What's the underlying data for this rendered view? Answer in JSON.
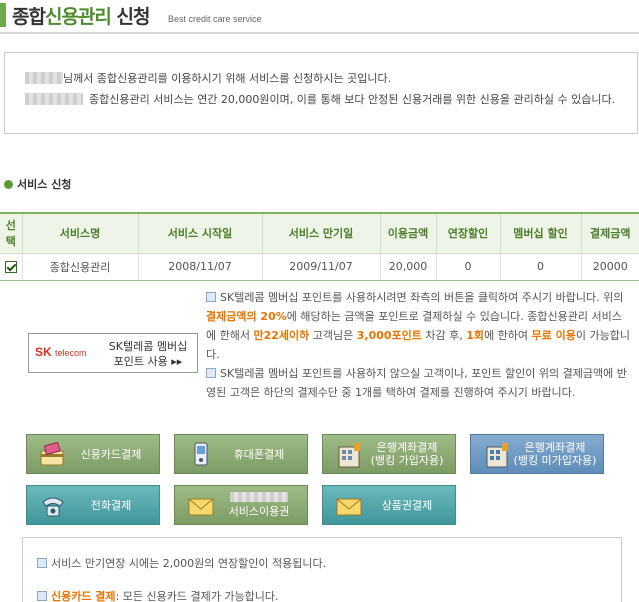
{
  "header": {
    "title_prefix": "종합",
    "title_highlight": "신용관리",
    "title_suffix": " 신청",
    "subtitle": "Best credit care service"
  },
  "intro": {
    "line1": "님께서 종합신용관리를 이용하시기 위해 서비스를 신청하시는 곳입니다.",
    "line2": "종합신용관리 서비스는 연간 20,000원이며, 이를 통해 보다 안정된 신용거래를 위한 신용을 관리하실 수 있습니다."
  },
  "section_title": "서비스 신청",
  "table": {
    "headers": [
      "선택",
      "서비스명",
      "서비스 시작일",
      "서비스 만기일",
      "이용금액",
      "연장할인",
      "멤버십 할인",
      "결제금액"
    ],
    "rows": [
      {
        "selected": true,
        "name": "종합신용관리",
        "start": "2008/11/07",
        "end": "2009/11/07",
        "amount": "20,000",
        "ext_discount": "0",
        "member_discount": "0",
        "total": "20000"
      }
    ]
  },
  "sk_button": {
    "logo_sk": "SK",
    "logo_telecom": "telecom",
    "text_line1": "SK텔레콤 멤버십",
    "text_line2": "포인트 사용 ▸▸"
  },
  "desc": {
    "p1_a": "SK텔레콤 멤버십 포인트를 사용하시려면 좌측의 버튼을 클릭하여 주시기 바랍니다. 위의 ",
    "p1_b": "결제금액의 20%",
    "p1_c": "에 해당하는 금액을 포인트로 결제하실 수 있습니다. 종합신용관리 서비스에 한해서 ",
    "p1_d": "만22세이하",
    "p1_e": " 고객님은 ",
    "p1_f": "3,000포인트",
    "p1_g": " 차감 후, ",
    "p1_h": "1회",
    "p1_i": "에 한하여 ",
    "p1_j": "무료 이용",
    "p1_k": "이 가능합니다.",
    "p2": "SK텔레콤 멤버십 포인트를 사용하지 않으실 고객이나, 포인트 할인이 위의 결제금액에 반영된 고객은 하단의 결제수단 중 1개를 택하여 결제를 진행하여 주시기 바랍니다."
  },
  "payments": [
    {
      "label": "신용카드결제",
      "icon": "credit-card-icon"
    },
    {
      "label": "휴대폰결제",
      "icon": "mobile-phone-icon"
    },
    {
      "label": "은행계좌결제\n(뱅킹 가입자용)",
      "icon": "bank-building-icon"
    },
    {
      "label": "은행계좌결제\n(뱅킹 미가입자용)",
      "icon": "bank-building-icon"
    },
    {
      "label": "전화결제",
      "icon": "telephone-icon"
    },
    {
      "label": "서비스이용권",
      "icon": "envelope-icon"
    },
    {
      "label": "상품권결제",
      "icon": "envelope-icon"
    }
  ],
  "notes": {
    "n1": "서비스 만기연장 시에는 2,000원의 연장할인이 적용됩니다.",
    "n2_a": "신용카드 결제",
    "n2_b": ": 모든 신용카드 결제가 가능합니다."
  },
  "colors": {
    "accent_green": "#4f8a2b",
    "header_bg": "#eef4e7",
    "highlight_orange": "#e87400",
    "button_green": "#8aa873",
    "button_blue": "#6f98c2",
    "button_teal": "#54a6a9"
  }
}
